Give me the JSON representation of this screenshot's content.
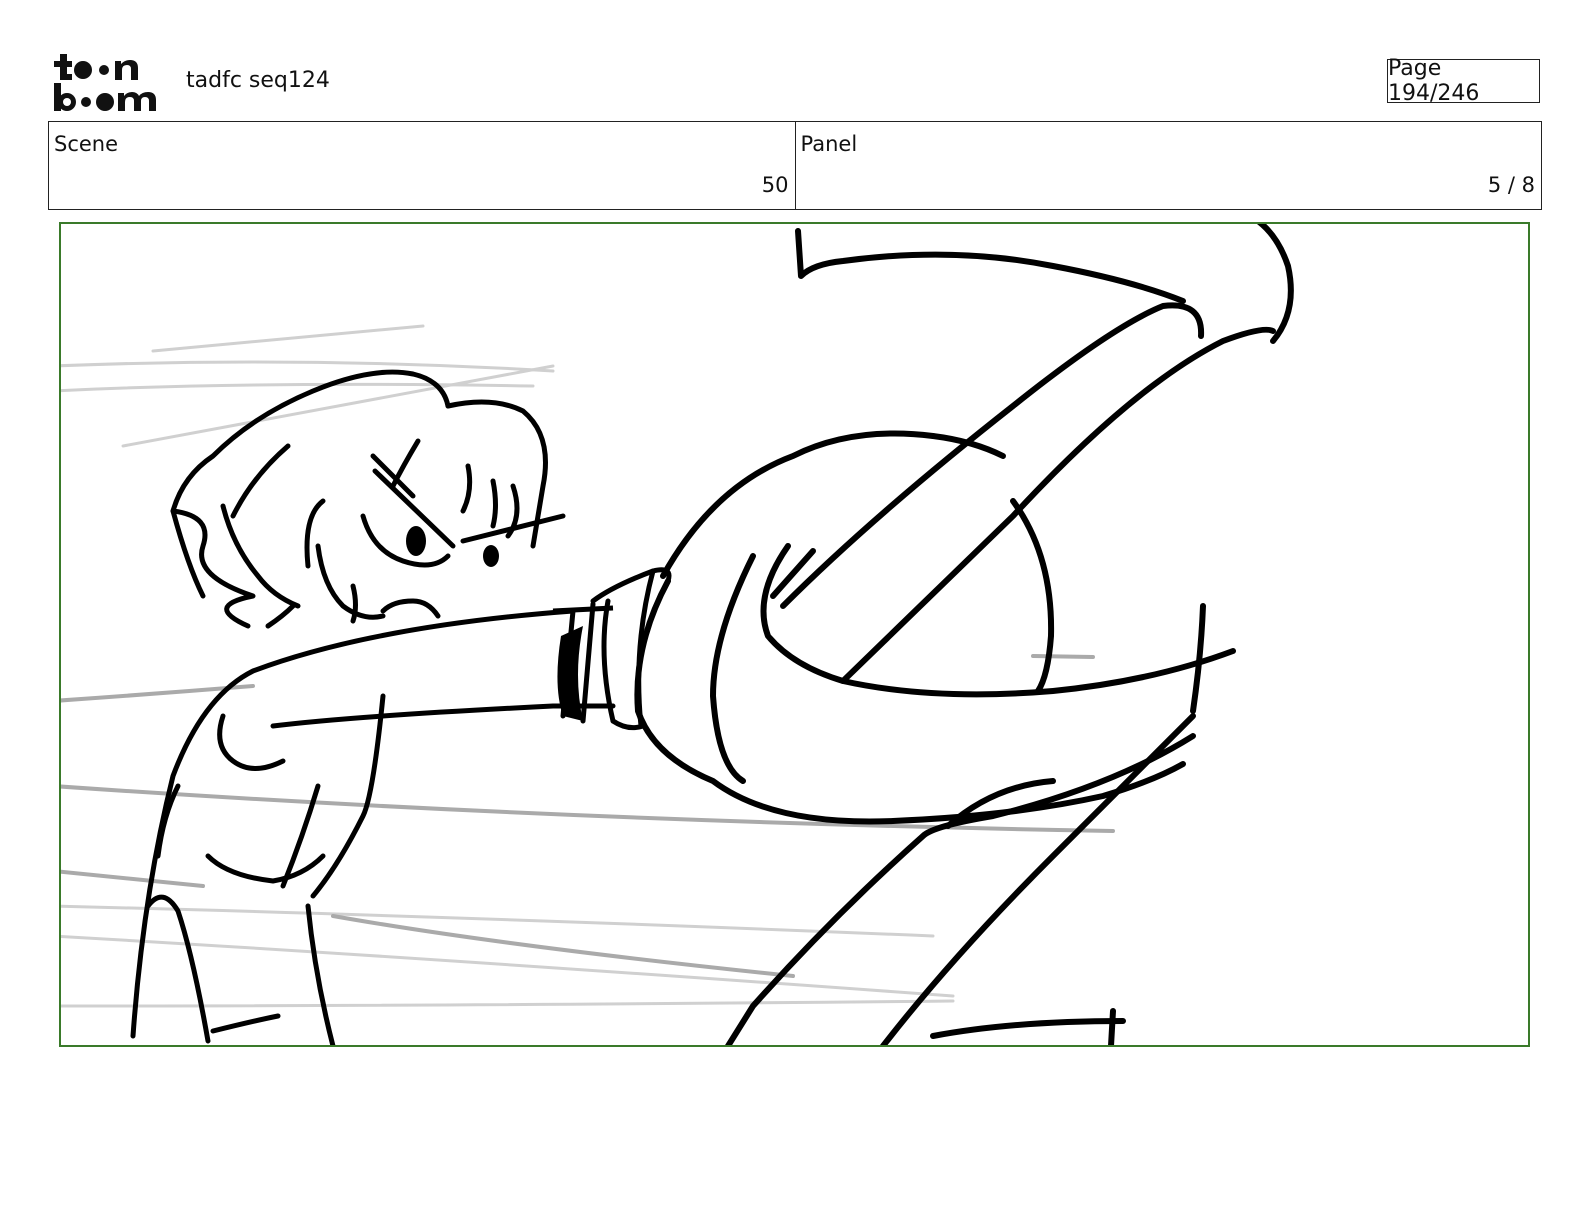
{
  "header": {
    "logo_text": "toon boom",
    "project_title": "tadfc seq124",
    "page_label": "Page 194/246"
  },
  "info": {
    "scene_label": "Scene",
    "scene_value": "50",
    "panel_label": "Panel",
    "panel_value": "5 / 8"
  },
  "colors": {
    "frame_border": "#3a7a2a",
    "ink": "#000000",
    "speed_lines": "#b5b5b5"
  }
}
